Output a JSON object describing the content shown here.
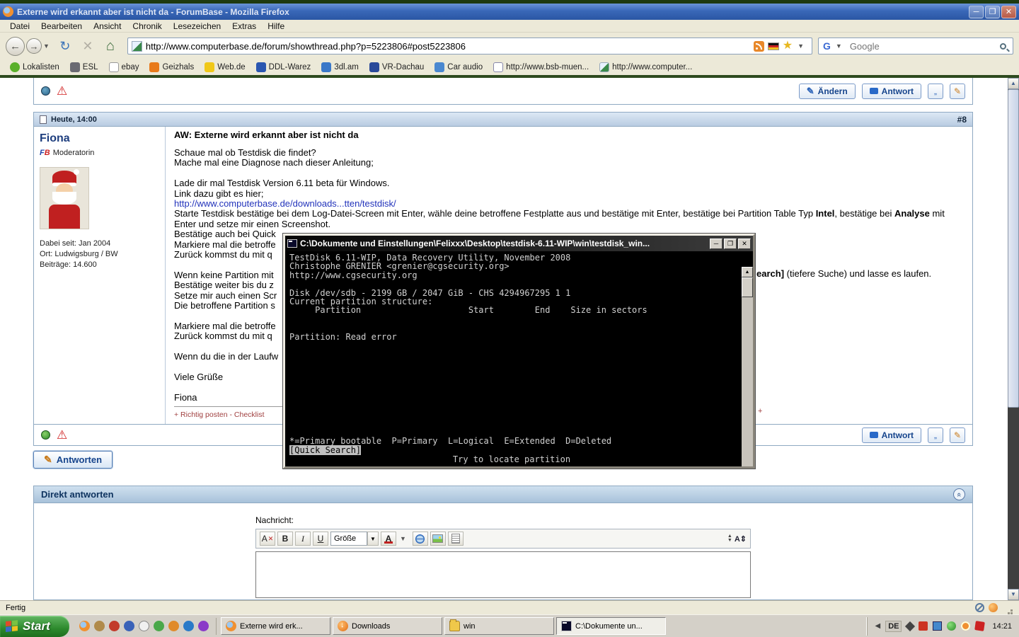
{
  "theme": {
    "titlebar_blue": "#3a68b8",
    "page_green_bar": "#2d4a1e",
    "forum_accent_blue": "#15448c",
    "console_background": "#000000"
  },
  "window": {
    "title": "Externe wird erkannt aber ist nicht da - ForumBase - Mozilla Firefox"
  },
  "menubar": {
    "items": [
      "Datei",
      "Bearbeiten",
      "Ansicht",
      "Chronik",
      "Lesezeichen",
      "Extras",
      "Hilfe"
    ]
  },
  "navbar": {
    "url": "http://www.computerbase.de/forum/showthread.php?p=5223806#post5223806",
    "search_placeholder": "Google",
    "search_logo": "G"
  },
  "bookmarks": {
    "items": [
      {
        "label": "Lokalisten"
      },
      {
        "label": "ESL"
      },
      {
        "label": "ebay"
      },
      {
        "label": "Geizhals"
      },
      {
        "label": "Web.de"
      },
      {
        "label": "DDL-Warez"
      },
      {
        "label": "3dl.am"
      },
      {
        "label": "VR-Dachau"
      },
      {
        "label": "Car audio"
      },
      {
        "label": "http://www.bsb-muen..."
      },
      {
        "label": "http://www.computer..."
      }
    ]
  },
  "forum": {
    "buttons": {
      "edit": "Ändern",
      "reply": "Antwort",
      "reply_all": "Antworten"
    },
    "post": {
      "date": "Heute, 14:00",
      "number": "#8",
      "author": {
        "name": "Fiona",
        "badge_f": "F",
        "badge_b": "B",
        "role": "Moderatorin",
        "joined": "Dabei seit: Jan 2004",
        "location": "Ort: Ludwigsburg / BW",
        "posts": "Beiträge: 14.600"
      },
      "title": "AW: Externe wird erkannt aber ist nicht da",
      "body": {
        "l1": "Schaue mal ob Testdisk die findet?",
        "l2": "Mache mal eine Diagnose nach dieser Anleitung;",
        "l3": "Lade dir mal Testdisk Version 6.11 beta für Windows.",
        "l4": "Link dazu gibt es hier;",
        "link": "http://www.computerbase.de/downloads...tten/testdisk/",
        "l5a": "Starte Testdisk bestätige bei dem Log-Datei-Screen mit Enter, wähle deine betroffene Festplatte aus und bestätige mit Enter, bestätige bei Partition Table Typ ",
        "l5b": "Intel",
        "l5c": ", bestätige bei ",
        "l5d": "Analyse",
        "l5e": " mit Enter und setze mir einen Screenshot.",
        "l6": "Bestätige auch bei Quick",
        "l7": "Markiere mal die betroffe",
        "l8": "Zurück kommst du mit q",
        "l9": "Wenn keine Partition mit",
        "frag_bold": "earch]",
        "frag": " (tiefere Suche) und lasse es laufen.",
        "l10": "Bestätige weiter bis du z",
        "l11": "Setze mir auch einen Scr",
        "l12": "Die betroffene Partition s",
        "l13": "Markiere mal die betroffe",
        "l14": "Zurück kommst du mit q",
        "l15": "Wenn du die in der Laufw",
        "l16": "Viele Grüße",
        "l17": "Fiona",
        "sig": "+ Richtig posten - Checklist",
        "sig_right": "+"
      }
    },
    "quick_reply": {
      "title": "Direkt antworten",
      "message_label": "Nachricht:",
      "toolbar": {
        "remove_format": "A",
        "bold": "B",
        "italic": "I",
        "underline": "U",
        "size": "Größe",
        "font_color": "A"
      }
    }
  },
  "console": {
    "title": "C:\\Dokumente und Einstellungen\\Felixxx\\Desktop\\testdisk-6.11-WIP\\win\\testdisk_win...",
    "lines": [
      "TestDisk 6.11-WIP, Data Recovery Utility, November 2008",
      "Christophe GRENIER <grenier@cgsecurity.org>",
      "http://www.cgsecurity.org",
      "",
      "Disk /dev/sdb - 2199 GB / 2047 GiB - CHS 4294967295 1 1",
      "Current partition structure:",
      "     Partition                     Start        End    Size in sectors",
      "",
      "",
      "Partition: Read error"
    ],
    "footer": "*=Primary bootable  P=Primary  L=Logical  E=Extended  D=Deleted",
    "selected": "[Quick Search]",
    "action": "Try to locate partition"
  },
  "statusbar": {
    "text": "Fertig"
  },
  "taskbar": {
    "start": "Start",
    "tasks": [
      {
        "label": "Externe wird erk..."
      },
      {
        "label": "Downloads"
      },
      {
        "label": "win"
      },
      {
        "label": "C:\\Dokumente un..."
      }
    ],
    "tray": {
      "language": "DE",
      "time": "14:21"
    }
  }
}
